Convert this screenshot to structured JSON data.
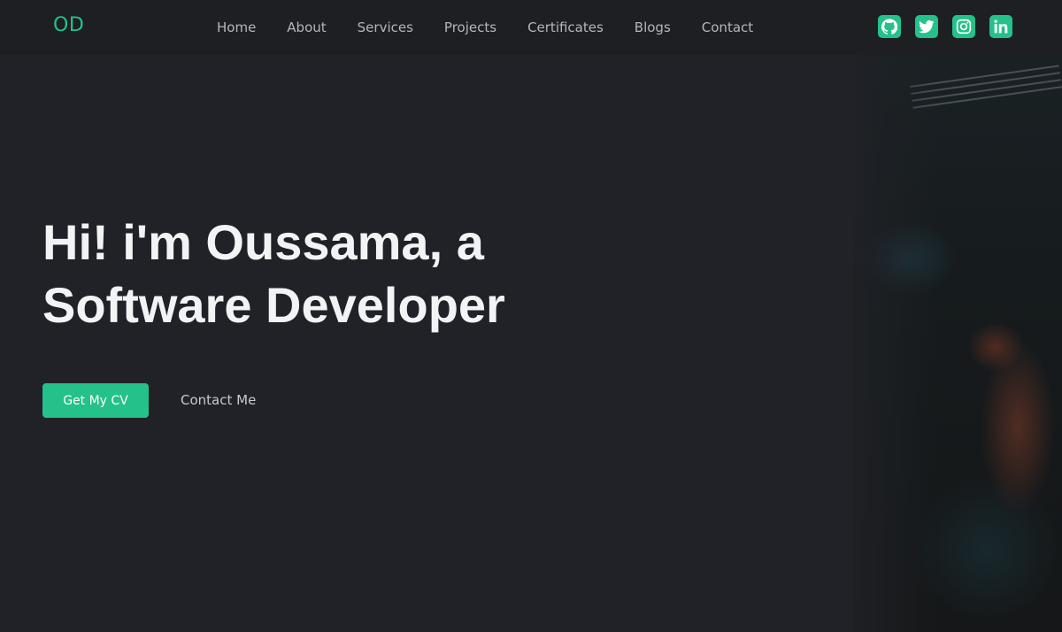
{
  "navbar": {
    "logo": "OD",
    "links": [
      {
        "label": "Home"
      },
      {
        "label": "About"
      },
      {
        "label": "Services"
      },
      {
        "label": "Projects"
      },
      {
        "label": "Certificates"
      },
      {
        "label": "Blogs"
      },
      {
        "label": "Contact"
      }
    ],
    "socials": [
      {
        "icon": "github-icon"
      },
      {
        "icon": "twitter-icon"
      },
      {
        "icon": "instagram-icon"
      },
      {
        "icon": "linkedin-icon"
      }
    ]
  },
  "hero": {
    "title_line1": "Hi! i'm Oussama, a",
    "title_line2": "Software Developer",
    "cv_button": "Get My CV",
    "contact_button": "Contact Me"
  },
  "colors": {
    "accent": "#24c18a",
    "background": "#202227",
    "navbar": "#1d1f23",
    "heading": "#f2f3f5"
  }
}
